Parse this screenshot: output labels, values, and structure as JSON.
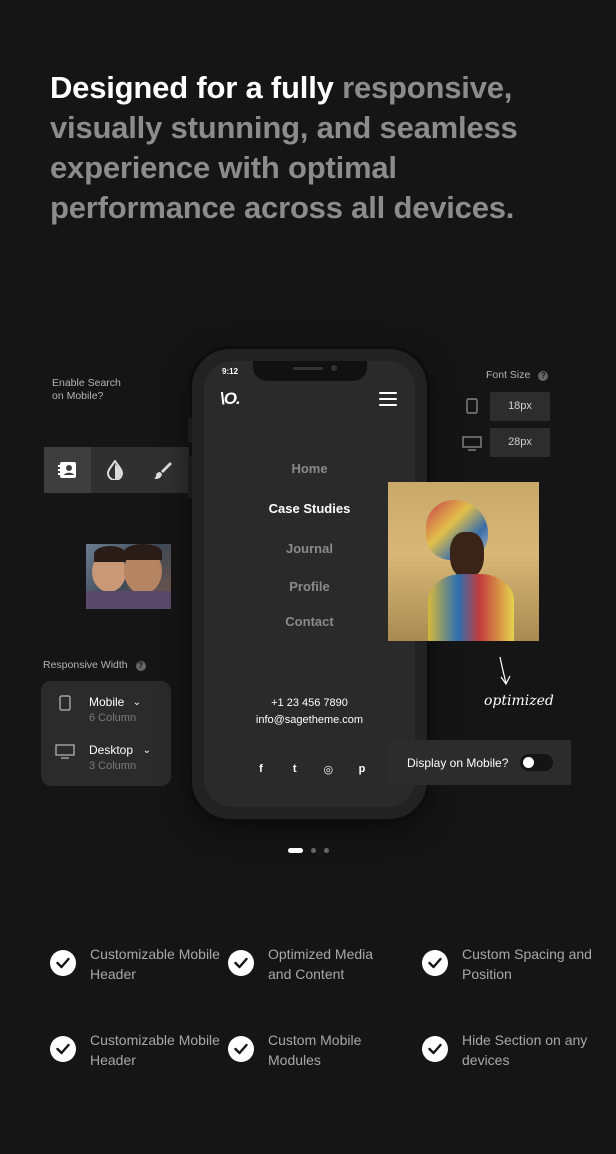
{
  "headline": {
    "white": "Designed for a fully",
    "gray": " responsive, visually stunning, and seamless experience with optimal performance across all devices."
  },
  "phone": {
    "time": "9:12",
    "logo": "\\O.",
    "menu": [
      "Home",
      "Case Studies",
      "Journal",
      "Profile",
      "Contact"
    ],
    "active_menu": "Case Studies",
    "phone_number": "+1 23 456 7890",
    "email": "info@sagetheme.com",
    "socials": [
      "facebook-icon",
      "twitter-icon",
      "instagram-icon",
      "pinterest-icon"
    ],
    "social_glyphs": [
      "f",
      "t",
      "◎",
      "p"
    ]
  },
  "search_setting": {
    "label_line1": "Enable Search",
    "label_line2": "on Mobile?"
  },
  "toolbar": {
    "tools": [
      "contact-card-icon",
      "contrast-icon",
      "brush-icon",
      "paint-bucket-icon"
    ]
  },
  "responsive_width": {
    "label": "Responsive Width",
    "rows": [
      {
        "device": "Mobile",
        "columns": "6 Column"
      },
      {
        "device": "Desktop",
        "columns": "3 Column"
      }
    ]
  },
  "font_size": {
    "label": "Font Size",
    "mobile_value": "18px",
    "desktop_value": "28px"
  },
  "display_mobile": {
    "label": "Display on Mobile?",
    "enabled": false
  },
  "annotation": "optimized",
  "carousel": {
    "pages": 3,
    "active": 1
  },
  "features": [
    "Customizable Mobile Header",
    "Optimized Media and Content",
    "Custom Spacing and Position",
    "Customizable Mobile Header",
    "Custom Mobile Modules",
    "Hide Section on any devices"
  ],
  "colors": {
    "background": "#151515",
    "panel": "#2b2b2b",
    "accent_white": "#ffffff",
    "muted": "#8c8c8c"
  }
}
